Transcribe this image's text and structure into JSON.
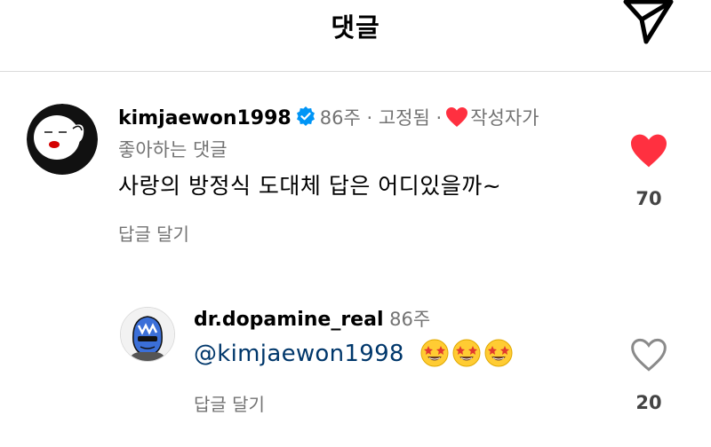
{
  "header": {
    "title": "댓글",
    "share_icon": "paper-plane-icon"
  },
  "comments": [
    {
      "username": "kimjaewon1998",
      "verified": true,
      "time": "86주",
      "separator": "·",
      "pinned": "고정됨",
      "author_liked_a": "작성자가",
      "author_liked_b": "좋아하는 댓글",
      "text": "사랑의 방정식 도대체 답은 어디있을까~",
      "reply_label": "답글 달기",
      "liked": true,
      "like_count": "70"
    },
    {
      "username": "dr.dopamine_real",
      "time": "86주",
      "mention": "@kimjaewon1998",
      "emojis": [
        "star-struck-emoji",
        "star-struck-emoji",
        "star-struck-emoji"
      ],
      "reply_label": "답글 달기",
      "liked": false,
      "like_count": "20"
    }
  ],
  "colors": {
    "like_red": "#ff3040",
    "verified_blue": "#0095f6",
    "mention_blue": "#00376b",
    "muted": "#737373"
  }
}
